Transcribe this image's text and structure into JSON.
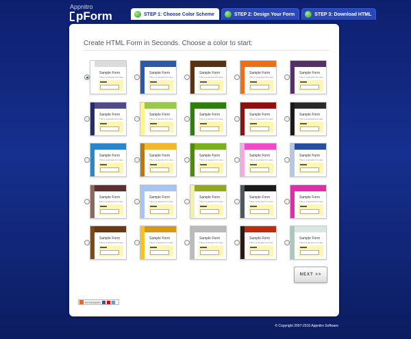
{
  "logo": {
    "small": "Appnitro",
    "big": "pForm"
  },
  "steps": [
    {
      "label": "STEP 1: Choose Color Scheme",
      "active": true
    },
    {
      "label": "STEP 2: Design Your Form",
      "active": false
    },
    {
      "label": "STEP 3: Download HTML",
      "active": false
    }
  ],
  "panel": {
    "title": "Create HTML Form in Seconds. Choose a color to start:"
  },
  "swatch_text": {
    "heading": "Sample Form",
    "sub": "This is a sample form des..."
  },
  "color_options": [
    {
      "top": "#dcdcdc",
      "side": "#ffffff",
      "field": "#fff6b0",
      "checked": true
    },
    {
      "top": "#2d5aa8",
      "side": "#2d5aa8",
      "field": "#fff6b0"
    },
    {
      "top": "#5a3212",
      "side": "#5a3212",
      "field": "#fff6b0"
    },
    {
      "top": "#f06e16",
      "side": "#f06e16",
      "field": "#fff6b0"
    },
    {
      "top": "#57306a",
      "side": "#57306a",
      "field": "#fff6b0"
    },
    {
      "top": "#4f4a8a",
      "side": "#2a2a6a",
      "field": "#fff6b0"
    },
    {
      "top": "#98c948",
      "side": "#fff48a",
      "field": "#fff6b0"
    },
    {
      "top": "#2f7e10",
      "side": "#2f7e10",
      "field": "#fff6b0"
    },
    {
      "top": "#8f1010",
      "side": "#8f1010",
      "field": "#fff6b0"
    },
    {
      "top": "#2a2a2a",
      "side": "#1a1a1a",
      "field": "#fff6b0"
    },
    {
      "top": "#2a86c8",
      "side": "#2a86c8",
      "field": "#fff6b0"
    },
    {
      "top": "#f0b82a",
      "side": "#b77a12",
      "field": "#fff6b0"
    },
    {
      "top": "#78b01e",
      "side": "#4e8a0e",
      "field": "#fff6b0"
    },
    {
      "top": "#ee4cc8",
      "side": "#f8a8e4",
      "field": "#fff6b0"
    },
    {
      "top": "#2a4e9e",
      "side": "#b4c8e6",
      "field": "#fff6b0"
    },
    {
      "top": "#5c3030",
      "side": "#8a6a60",
      "field": "#fff6b0"
    },
    {
      "top": "#a8c4f0",
      "side": "#a8c4f0",
      "field": "#fff6b0"
    },
    {
      "top": "#93a81c",
      "side": "#f2efb2",
      "field": "#fff6b0"
    },
    {
      "top": "#1a1a1a",
      "side": "#4e565e",
      "field": "#fff6b0"
    },
    {
      "top": "#e02ea8",
      "side": "#e02ea8",
      "field": "#fff6b0"
    },
    {
      "top": "#6a3812",
      "side": "#7a4a1e",
      "field": "#fff6b0"
    },
    {
      "top": "#d89a0a",
      "side": "#f8c21e",
      "field": "#fff6b0"
    },
    {
      "top": "#bababa",
      "side": "#bababa",
      "field": "#fff6b0"
    },
    {
      "top": "#c22a10",
      "side": "#2a1a10",
      "field": "#fff6b0"
    },
    {
      "top": "#d8e8e0",
      "side": "#a8c8c0",
      "field": "#fff6b0"
    }
  ],
  "next_button": {
    "label": "NEXT >>"
  },
  "bookmark": {
    "label": "BOOKMARK"
  },
  "footer": {
    "copyright": "© Copyright 2007-2010 Appnitro Software"
  }
}
